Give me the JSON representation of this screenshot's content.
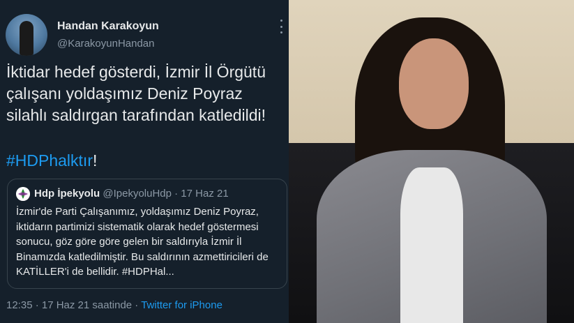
{
  "tweet": {
    "author_name": "Handan Karakoyun",
    "author_handle": "@KarakoyunHandan",
    "text": "İktidar hedef gösterdi, İzmir İl Örgütü çalışanı yoldaşımız Deniz Poyraz silahlı saldırgan tarafından katledildi!",
    "hashtag": "#HDPhalktır",
    "hashtag_suffix": "!",
    "quoted": {
      "name": "Hdp İpekyolu",
      "handle_date": "@IpekyoluHdp · 17 Haz 21",
      "text": "İzmir'de Parti Çalışanımız, yoldaşımız Deniz Poyraz, iktidarın partimizi sistematik olarak hedef göstermesi sonucu, göz göre göre gelen bir saldırıyla İzmir İl Binamızda katledilmiştir. Bu saldırının azmettiricileri de KATİLLER'i de bellidir. #HDPHal..."
    },
    "footer_time": "12:35 · 17 Haz 21 saatinde · ",
    "footer_app": "Twitter for iPhone"
  },
  "icons": {
    "more": "more-vertical-icon",
    "quoted_avatar": "hdp-logo-icon"
  },
  "colors": {
    "background": "#15202b",
    "link": "#1d9bf0",
    "secondary_text": "#8b98a5",
    "border": "#38444d"
  }
}
